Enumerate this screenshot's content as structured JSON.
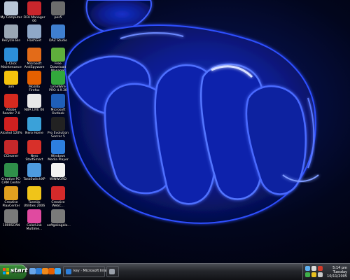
{
  "desktop": {
    "icons": [
      {
        "label": "My Computer",
        "icon": "computer-icon",
        "color": "#b9c6d6"
      },
      {
        "label": "FIFA Manager 06",
        "icon": "fifa-manager-icon",
        "color": "#c8262c"
      },
      {
        "label": "pes5",
        "icon": "folder-icon",
        "color": "#6c6c6c"
      },
      {
        "label": "Recycle Bin",
        "icon": "recycle-bin-icon",
        "color": "#9aa7b4"
      },
      {
        "label": "FlashGet",
        "icon": "flashget-icon",
        "color": "#8fa8c8"
      },
      {
        "label": "DAZ Studio",
        "icon": "daz-studio-icon",
        "color": "#3f7fd0"
      },
      {
        "label": "1-Click Maintenance",
        "icon": "maintenance-icon",
        "color": "#2c8ed9"
      },
      {
        "label": "Microsoft AntiSpyware",
        "icon": "antispyware-icon",
        "color": "#e36b18"
      },
      {
        "label": "Free Download Manager",
        "icon": "download-manager-icon",
        "color": "#5fae3c"
      },
      {
        "label": "aim",
        "icon": "aim-icon",
        "color": "#f4c20d"
      },
      {
        "label": "Mozilla Firefox",
        "icon": "firefox-icon",
        "color": "#e66000"
      },
      {
        "label": "LimeWire PRO 4.9.30",
        "icon": "limewire-icon",
        "color": "#32a83c"
      },
      {
        "label": "Adobe Reader 7.0",
        "icon": "adobe-reader-icon",
        "color": "#d62a1f"
      },
      {
        "label": "NBA LIVE 06",
        "icon": "nba-live-icon",
        "color": "#e8e8e8"
      },
      {
        "label": "Microsoft Outlook",
        "icon": "outlook-icon",
        "color": "#1f5fb8"
      },
      {
        "label": "Alcohol 120%",
        "icon": "alcohol-icon",
        "color": "#d02020"
      },
      {
        "label": "Nero Home",
        "icon": "nero-home-icon",
        "color": "#3aa1d9"
      },
      {
        "label": "Pro Evolution Soccer 5",
        "icon": "pes5-icon",
        "color": "#222222"
      },
      {
        "label": "CCleaner",
        "icon": "ccleaner-icon",
        "color": "#c4282a"
      },
      {
        "label": "Nero StartSmart",
        "icon": "nero-startsmart-icon",
        "color": "#d8302a"
      },
      {
        "label": "Windows Media Player",
        "icon": "media-player-icon",
        "color": "#2d7fe0"
      },
      {
        "label": "Creative PC-CAM Center",
        "icon": "pc-cam-icon",
        "color": "#2f8f4a"
      },
      {
        "label": "TaskSwitchXP",
        "icon": "taskswitch-icon",
        "color": "#4d9be0"
      },
      {
        "label": "WINWORD",
        "icon": "word-icon",
        "color": "#f2f2f2"
      },
      {
        "label": "Creative PlayCenter",
        "icon": "playcenter-icon",
        "color": "#e0a020"
      },
      {
        "label": "TuneUp Utilities 2006",
        "icon": "tuneup-icon",
        "color": "#f0c419"
      },
      {
        "label": "Creative WebC...",
        "icon": "webcam-icon",
        "color": "#d42a2a"
      },
      {
        "label": "1000SCAN",
        "icon": "scan-folder-icon",
        "color": "#7a7a7a"
      },
      {
        "label": "ColorLink Multime...",
        "icon": "colorlink-icon",
        "color": "#e04aa0"
      },
      {
        "label": "softgekagalo...",
        "icon": "folder-icon",
        "color": "#7a7a7a"
      }
    ]
  },
  "taskbar": {
    "start_label": "start",
    "quick_launch": [
      {
        "icon": "show-desktop-icon",
        "color": "#6aa6e8"
      },
      {
        "icon": "internet-explorer-icon",
        "color": "#2f7fd8"
      },
      {
        "icon": "media-player-icon",
        "color": "#f08a1c"
      },
      {
        "icon": "firefox-icon",
        "color": "#e66000"
      },
      {
        "icon": "messenger-icon",
        "color": "#3fa9f5"
      }
    ],
    "tasks": [
      {
        "label": "key · Microsoft Intern...",
        "icon": "internet-explorer-icon"
      },
      {
        "label": "",
        "icon": "window-icon"
      }
    ],
    "tray": {
      "icons": [
        {
          "icon": "network-icon",
          "color": "#5fb0f0"
        },
        {
          "icon": "volume-icon",
          "color": "#d8d8d8"
        },
        {
          "icon": "antivirus-icon",
          "color": "#d23a2a"
        },
        {
          "icon": "messenger-tray-icon",
          "color": "#3fb04a"
        },
        {
          "icon": "update-icon",
          "color": "#e8c020"
        },
        {
          "icon": "security-icon",
          "color": "#c8c8c8"
        }
      ],
      "time": "5:14 pm",
      "day": "Tuesday",
      "date": "10/11/2005"
    }
  }
}
